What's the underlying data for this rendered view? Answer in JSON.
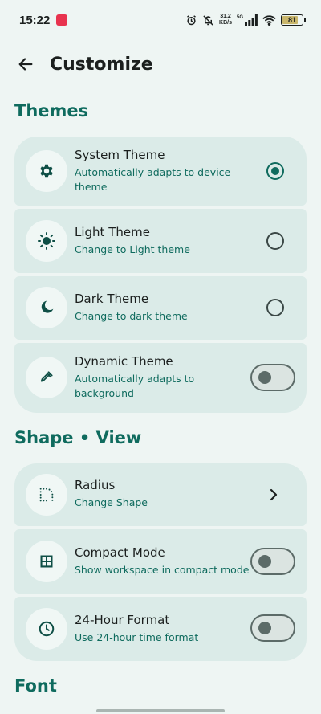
{
  "status_bar": {
    "time": "15:22",
    "speed_value": "31.2",
    "speed_unit": "KB/s",
    "network": "5G",
    "battery": "81",
    "battery_level_percent": 81
  },
  "header": {
    "title": "Customize"
  },
  "sections": {
    "themes": "Themes",
    "shape_view": "Shape • View",
    "font": "Font"
  },
  "themes": {
    "system": {
      "title": "System Theme",
      "subtitle": "Automatically adapts to device theme",
      "selected": true
    },
    "light": {
      "title": "Light Theme",
      "subtitle": "Change to Light theme",
      "selected": false
    },
    "dark": {
      "title": "Dark Theme",
      "subtitle": "Change to dark theme",
      "selected": false
    },
    "dynamic": {
      "title": "Dynamic Theme",
      "subtitle": "Automatically adapts to background",
      "enabled": false
    }
  },
  "shape_view": {
    "radius": {
      "title": "Radius",
      "subtitle": "Change Shape"
    },
    "compact": {
      "title": "Compact Mode",
      "subtitle": "Show workspace in compact mode",
      "enabled": false
    },
    "hour24": {
      "title": "24-Hour Format",
      "subtitle": "Use 24-hour time format",
      "enabled": false
    }
  },
  "colors": {
    "accent": "#0f6b5e",
    "card": "#dbebe8",
    "background": "#eef5f3"
  }
}
